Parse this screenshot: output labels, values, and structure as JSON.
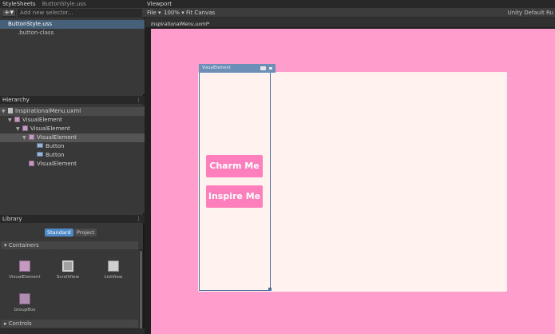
{
  "stylesheets": {
    "title": "StyleSheets",
    "file_tab": "ButtonStyle.uss",
    "add_button": "+▾",
    "selector_placeholder": "Add new selector...",
    "items": [
      {
        "label": "ButtonStyle.uss",
        "selected": true
      },
      {
        "label": ".button-class",
        "selected": false
      }
    ]
  },
  "hierarchy": {
    "title": "Hierarchy",
    "menu": "⋮",
    "items": [
      {
        "label": "InspirationalMenu.uxml",
        "depth": 0,
        "icon": "document-icon"
      },
      {
        "label": "VisualElement",
        "depth": 1,
        "icon": "visual-element-icon"
      },
      {
        "label": "VisualElement",
        "depth": 2,
        "icon": "visual-element-icon"
      },
      {
        "label": "VisualElement",
        "depth": 3,
        "icon": "visual-element-icon",
        "selected": true
      },
      {
        "label": "Button",
        "depth": 4,
        "icon": "button-icon"
      },
      {
        "label": "Button",
        "depth": 4,
        "icon": "button-icon"
      },
      {
        "label": "VisualElement",
        "depth": 3,
        "icon": "visual-element-icon"
      }
    ]
  },
  "library": {
    "title": "Library",
    "menu": "⋮",
    "tabs": [
      "Standard",
      "Project"
    ],
    "active_tab": "Standard",
    "sections": [
      {
        "label": "Containers",
        "items": [
          {
            "label": "VisualElement",
            "icon": "visual-element-icon"
          },
          {
            "label": "ScrollView",
            "icon": "scroll-view-icon"
          },
          {
            "label": "ListView",
            "icon": "list-view-icon"
          },
          {
            "label": "GroupBox",
            "icon": "group-box-icon"
          }
        ]
      },
      {
        "label": "Controls",
        "items": []
      }
    ]
  },
  "viewport": {
    "title": "Viewport",
    "file_menu": "File ▾",
    "zoom": "100% ▾",
    "fit_canvas": "Fit Canvas",
    "theme": "Unity Default Ru",
    "document_tab": "InspirationalMenu.uxml*",
    "selected_element_label": "VisualElement",
    "canvas_buttons": [
      "Charm Me",
      "Inspire Me"
    ]
  },
  "colors": {
    "canvas_background": "#ff9dcc",
    "panel_background": "#fff2ef",
    "button_background": "#ff7fbd",
    "button_text": "#ffffff",
    "selection_outline": "#4a6e9c",
    "editor_background": "#383838",
    "accent": "#4d8ac7"
  }
}
